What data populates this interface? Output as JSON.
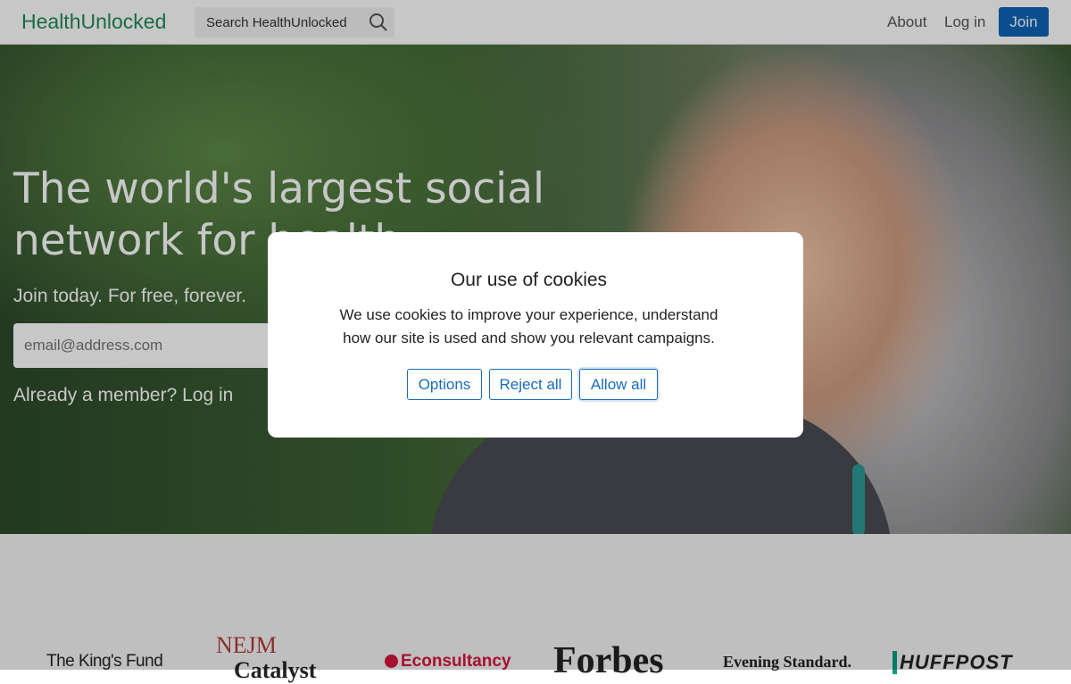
{
  "header": {
    "logo": "HealthUnlocked",
    "search_placeholder": "Search HealthUnlocked",
    "nav": {
      "about": "About",
      "login": "Log in",
      "join": "Join"
    }
  },
  "hero": {
    "title": "The world's largest social network for health",
    "subtitle": "Join today. For free, forever.",
    "email_placeholder": "email@address.com",
    "member_text": "Already a member? Log in"
  },
  "press_logos": {
    "kings_fund": "The King's Fund",
    "nejm_top": "NEJM",
    "nejm_bottom": "Catalyst",
    "econsultancy": "Econsultancy",
    "forbes": "Forbes",
    "evening_standard": "Evening Standard.",
    "huffpost": "HUFFPOST"
  },
  "cookie_modal": {
    "title": "Our use of cookies",
    "text": "We use cookies to improve your experience, understand how our site is used and show you relevant campaigns.",
    "buttons": {
      "options": "Options",
      "reject": "Reject all",
      "allow": "Allow all"
    }
  },
  "colors": {
    "brand": "#1f8a5b",
    "accent": "#0e64b7",
    "link": "#1a6cb8"
  }
}
